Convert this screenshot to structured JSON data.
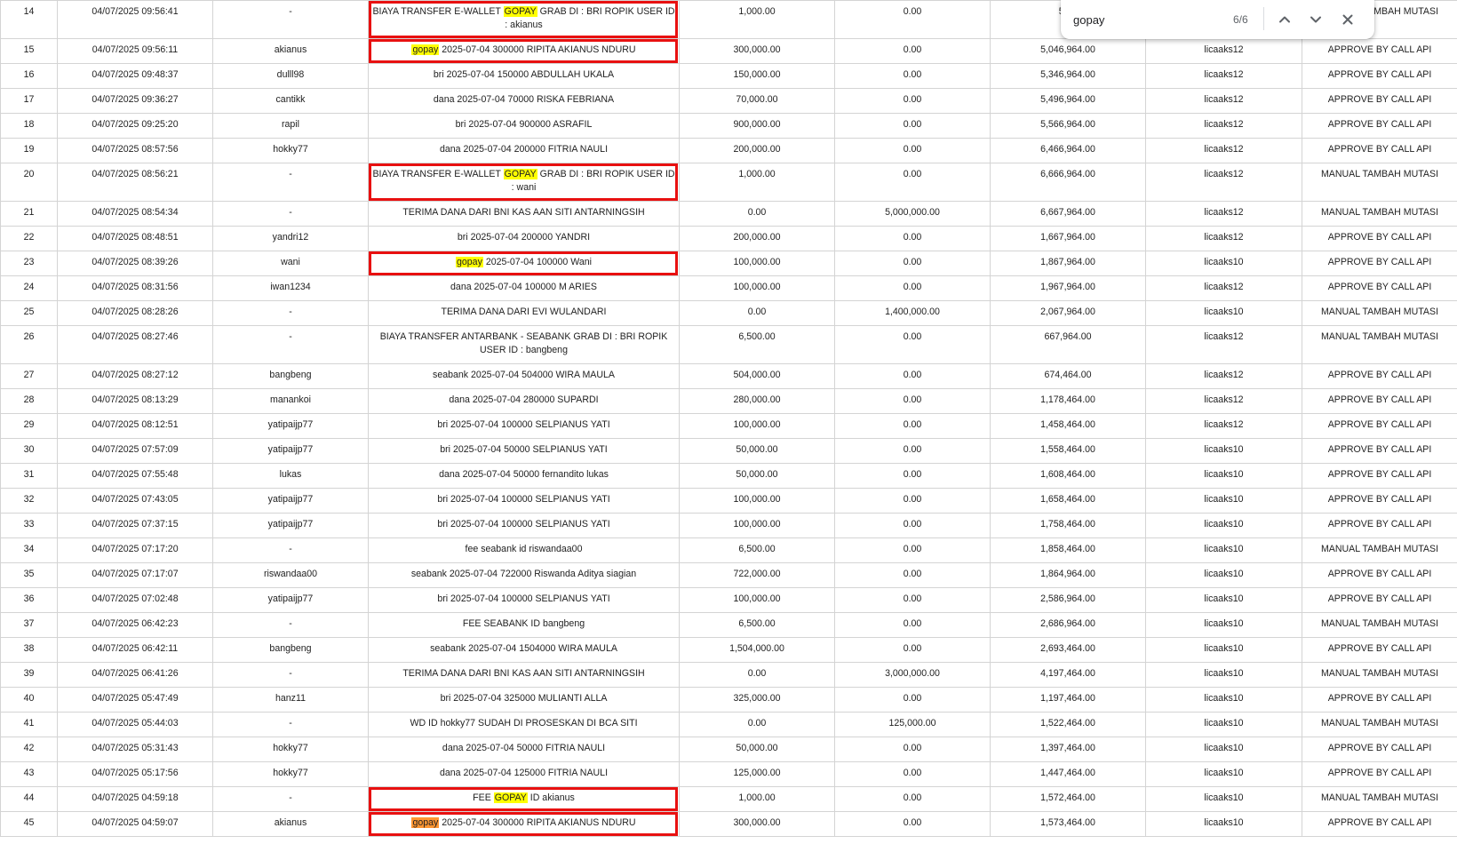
{
  "find_bar": {
    "query": "gopay",
    "match_count": "6/6",
    "prev_icon": "chevron-up-icon",
    "next_icon": "chevron-down-icon",
    "close_icon": "close-icon"
  },
  "colors": {
    "match_highlight": "#ffff00",
    "active_match_highlight": "#ff9632",
    "annotation_box": "#e81010"
  },
  "rows": [
    {
      "no": "14",
      "datetime": "04/07/2025 09:56:41",
      "user": "-",
      "desc": [
        {
          "t": "BIAYA TRANSFER E-WALLET "
        },
        {
          "t": "GOPAY",
          "m": true
        },
        {
          "t": " GRAB DI : BRI ROPIK USER ID : akianus"
        }
      ],
      "debit": "1,000.00",
      "credit": "0.00",
      "balance": "5,04",
      "admin": "",
      "status": "MANUAL TAMBAH MUTASI",
      "tall": true,
      "boxed": true
    },
    {
      "no": "15",
      "datetime": "04/07/2025 09:56:11",
      "user": "akianus",
      "desc": [
        {
          "t": "gopay",
          "m": true
        },
        {
          "t": " 2025-07-04 300000 RIPITA AKIANUS NDURU"
        }
      ],
      "debit": "300,000.00",
      "credit": "0.00",
      "balance": "5,046,964.00",
      "admin": "licaaks12",
      "status": "APPROVE BY CALL API",
      "boxed": true
    },
    {
      "no": "16",
      "datetime": "04/07/2025 09:48:37",
      "user": "dulll98",
      "desc": [
        {
          "t": "bri 2025-07-04 150000 ABDULLAH UKALA"
        }
      ],
      "debit": "150,000.00",
      "credit": "0.00",
      "balance": "5,346,964.00",
      "admin": "licaaks12",
      "status": "APPROVE BY CALL API"
    },
    {
      "no": "17",
      "datetime": "04/07/2025 09:36:27",
      "user": "cantikk",
      "desc": [
        {
          "t": "dana 2025-07-04 70000 RISKA FEBRIANA"
        }
      ],
      "debit": "70,000.00",
      "credit": "0.00",
      "balance": "5,496,964.00",
      "admin": "licaaks12",
      "status": "APPROVE BY CALL API"
    },
    {
      "no": "18",
      "datetime": "04/07/2025 09:25:20",
      "user": "rapil",
      "desc": [
        {
          "t": "bri 2025-07-04 900000 ASRAFIL"
        }
      ],
      "debit": "900,000.00",
      "credit": "0.00",
      "balance": "5,566,964.00",
      "admin": "licaaks12",
      "status": "APPROVE BY CALL API"
    },
    {
      "no": "19",
      "datetime": "04/07/2025 08:57:56",
      "user": "hokky77",
      "desc": [
        {
          "t": "dana 2025-07-04 200000 FITRIA NAULI"
        }
      ],
      "debit": "200,000.00",
      "credit": "0.00",
      "balance": "6,466,964.00",
      "admin": "licaaks12",
      "status": "APPROVE BY CALL API"
    },
    {
      "no": "20",
      "datetime": "04/07/2025 08:56:21",
      "user": "-",
      "desc": [
        {
          "t": "BIAYA TRANSFER E-WALLET "
        },
        {
          "t": "GOPAY",
          "m": true
        },
        {
          "t": " GRAB DI : BRI ROPIK USER ID : wani"
        }
      ],
      "debit": "1,000.00",
      "credit": "0.00",
      "balance": "6,666,964.00",
      "admin": "licaaks12",
      "status": "MANUAL TAMBAH MUTASI",
      "tall": true,
      "boxed": true
    },
    {
      "no": "21",
      "datetime": "04/07/2025 08:54:34",
      "user": "-",
      "desc": [
        {
          "t": "TERIMA DANA DARI BNI KAS AAN SITI ANTARNINGSIH"
        }
      ],
      "debit": "0.00",
      "credit": "5,000,000.00",
      "balance": "6,667,964.00",
      "admin": "licaaks12",
      "status": "MANUAL TAMBAH MUTASI"
    },
    {
      "no": "22",
      "datetime": "04/07/2025 08:48:51",
      "user": "yandri12",
      "desc": [
        {
          "t": "bri 2025-07-04 200000 YANDRI"
        }
      ],
      "debit": "200,000.00",
      "credit": "0.00",
      "balance": "1,667,964.00",
      "admin": "licaaks12",
      "status": "APPROVE BY CALL API"
    },
    {
      "no": "23",
      "datetime": "04/07/2025 08:39:26",
      "user": "wani",
      "desc": [
        {
          "t": "gopay",
          "m": true
        },
        {
          "t": " 2025-07-04 100000 Wani"
        }
      ],
      "debit": "100,000.00",
      "credit": "0.00",
      "balance": "1,867,964.00",
      "admin": "licaaks10",
      "status": "APPROVE BY CALL API",
      "boxed": true
    },
    {
      "no": "24",
      "datetime": "04/07/2025 08:31:56",
      "user": "iwan1234",
      "desc": [
        {
          "t": "dana 2025-07-04 100000 M ARIES"
        }
      ],
      "debit": "100,000.00",
      "credit": "0.00",
      "balance": "1,967,964.00",
      "admin": "licaaks12",
      "status": "APPROVE BY CALL API"
    },
    {
      "no": "25",
      "datetime": "04/07/2025 08:28:26",
      "user": "-",
      "desc": [
        {
          "t": "TERIMA DANA DARI EVI WULANDARI"
        }
      ],
      "debit": "0.00",
      "credit": "1,400,000.00",
      "balance": "2,067,964.00",
      "admin": "licaaks10",
      "status": "MANUAL TAMBAH MUTASI"
    },
    {
      "no": "26",
      "datetime": "04/07/2025 08:27:46",
      "user": "-",
      "desc": [
        {
          "t": "BIAYA TRANSFER ANTARBANK - SEABANK GRAB DI : BRI ROPIK USER ID : bangbeng"
        }
      ],
      "debit": "6,500.00",
      "credit": "0.00",
      "balance": "667,964.00",
      "admin": "licaaks12",
      "status": "MANUAL TAMBAH MUTASI",
      "tall": true
    },
    {
      "no": "27",
      "datetime": "04/07/2025 08:27:12",
      "user": "bangbeng",
      "desc": [
        {
          "t": "seabank 2025-07-04 504000 WIRA MAULA"
        }
      ],
      "debit": "504,000.00",
      "credit": "0.00",
      "balance": "674,464.00",
      "admin": "licaaks12",
      "status": "APPROVE BY CALL API"
    },
    {
      "no": "28",
      "datetime": "04/07/2025 08:13:29",
      "user": "manankoi",
      "desc": [
        {
          "t": "dana 2025-07-04 280000 SUPARDI"
        }
      ],
      "debit": "280,000.00",
      "credit": "0.00",
      "balance": "1,178,464.00",
      "admin": "licaaks12",
      "status": "APPROVE BY CALL API"
    },
    {
      "no": "29",
      "datetime": "04/07/2025 08:12:51",
      "user": "yatipaijp77",
      "desc": [
        {
          "t": "bri 2025-07-04 100000 SELPIANUS YATI"
        }
      ],
      "debit": "100,000.00",
      "credit": "0.00",
      "balance": "1,458,464.00",
      "admin": "licaaks12",
      "status": "APPROVE BY CALL API"
    },
    {
      "no": "30",
      "datetime": "04/07/2025 07:57:09",
      "user": "yatipaijp77",
      "desc": [
        {
          "t": "bri 2025-07-04 50000 SELPIANUS YATI"
        }
      ],
      "debit": "50,000.00",
      "credit": "0.00",
      "balance": "1,558,464.00",
      "admin": "licaaks10",
      "status": "APPROVE BY CALL API"
    },
    {
      "no": "31",
      "datetime": "04/07/2025 07:55:48",
      "user": "lukas",
      "desc": [
        {
          "t": "dana 2025-07-04 50000 fernandito lukas"
        }
      ],
      "debit": "50,000.00",
      "credit": "0.00",
      "balance": "1,608,464.00",
      "admin": "licaaks10",
      "status": "APPROVE BY CALL API"
    },
    {
      "no": "32",
      "datetime": "04/07/2025 07:43:05",
      "user": "yatipaijp77",
      "desc": [
        {
          "t": "bri 2025-07-04 100000 SELPIANUS YATI"
        }
      ],
      "debit": "100,000.00",
      "credit": "0.00",
      "balance": "1,658,464.00",
      "admin": "licaaks10",
      "status": "APPROVE BY CALL API"
    },
    {
      "no": "33",
      "datetime": "04/07/2025 07:37:15",
      "user": "yatipaijp77",
      "desc": [
        {
          "t": "bri 2025-07-04 100000 SELPIANUS YATI"
        }
      ],
      "debit": "100,000.00",
      "credit": "0.00",
      "balance": "1,758,464.00",
      "admin": "licaaks10",
      "status": "APPROVE BY CALL API"
    },
    {
      "no": "34",
      "datetime": "04/07/2025 07:17:20",
      "user": "-",
      "desc": [
        {
          "t": "fee seabank id riswandaa00"
        }
      ],
      "debit": "6,500.00",
      "credit": "0.00",
      "balance": "1,858,464.00",
      "admin": "licaaks10",
      "status": "MANUAL TAMBAH MUTASI"
    },
    {
      "no": "35",
      "datetime": "04/07/2025 07:17:07",
      "user": "riswandaa00",
      "desc": [
        {
          "t": "seabank 2025-07-04 722000 Riswanda Aditya siagian"
        }
      ],
      "debit": "722,000.00",
      "credit": "0.00",
      "balance": "1,864,964.00",
      "admin": "licaaks10",
      "status": "APPROVE BY CALL API"
    },
    {
      "no": "36",
      "datetime": "04/07/2025 07:02:48",
      "user": "yatipaijp77",
      "desc": [
        {
          "t": "bri 2025-07-04 100000 SELPIANUS YATI"
        }
      ],
      "debit": "100,000.00",
      "credit": "0.00",
      "balance": "2,586,964.00",
      "admin": "licaaks10",
      "status": "APPROVE BY CALL API"
    },
    {
      "no": "37",
      "datetime": "04/07/2025 06:42:23",
      "user": "-",
      "desc": [
        {
          "t": "FEE SEABANK ID bangbeng"
        }
      ],
      "debit": "6,500.00",
      "credit": "0.00",
      "balance": "2,686,964.00",
      "admin": "licaaks10",
      "status": "MANUAL TAMBAH MUTASI"
    },
    {
      "no": "38",
      "datetime": "04/07/2025 06:42:11",
      "user": "bangbeng",
      "desc": [
        {
          "t": "seabank 2025-07-04 1504000 WIRA MAULA"
        }
      ],
      "debit": "1,504,000.00",
      "credit": "0.00",
      "balance": "2,693,464.00",
      "admin": "licaaks10",
      "status": "APPROVE BY CALL API"
    },
    {
      "no": "39",
      "datetime": "04/07/2025 06:41:26",
      "user": "-",
      "desc": [
        {
          "t": "TERIMA DANA DARI BNI KAS AAN SITI ANTARNINGSIH"
        }
      ],
      "debit": "0.00",
      "credit": "3,000,000.00",
      "balance": "4,197,464.00",
      "admin": "licaaks10",
      "status": "MANUAL TAMBAH MUTASI"
    },
    {
      "no": "40",
      "datetime": "04/07/2025 05:47:49",
      "user": "hanz11",
      "desc": [
        {
          "t": "bri 2025-07-04 325000 MULIANTI ALLA"
        }
      ],
      "debit": "325,000.00",
      "credit": "0.00",
      "balance": "1,197,464.00",
      "admin": "licaaks10",
      "status": "APPROVE BY CALL API"
    },
    {
      "no": "41",
      "datetime": "04/07/2025 05:44:03",
      "user": "-",
      "desc": [
        {
          "t": "WD ID hokky77 SUDAH DI PROSESKAN DI BCA SITI"
        }
      ],
      "debit": "0.00",
      "credit": "125,000.00",
      "balance": "1,522,464.00",
      "admin": "licaaks10",
      "status": "MANUAL TAMBAH MUTASI"
    },
    {
      "no": "42",
      "datetime": "04/07/2025 05:31:43",
      "user": "hokky77",
      "desc": [
        {
          "t": "dana 2025-07-04 50000 FITRIA NAULI"
        }
      ],
      "debit": "50,000.00",
      "credit": "0.00",
      "balance": "1,397,464.00",
      "admin": "licaaks10",
      "status": "APPROVE BY CALL API"
    },
    {
      "no": "43",
      "datetime": "04/07/2025 05:17:56",
      "user": "hokky77",
      "desc": [
        {
          "t": "dana 2025-07-04 125000 FITRIA NAULI"
        }
      ],
      "debit": "125,000.00",
      "credit": "0.00",
      "balance": "1,447,464.00",
      "admin": "licaaks10",
      "status": "APPROVE BY CALL API"
    },
    {
      "no": "44",
      "datetime": "04/07/2025 04:59:18",
      "user": "-",
      "desc": [
        {
          "t": "FEE "
        },
        {
          "t": "GOPAY",
          "m": true
        },
        {
          "t": " ID akianus"
        }
      ],
      "debit": "1,000.00",
      "credit": "0.00",
      "balance": "1,572,464.00",
      "admin": "licaaks10",
      "status": "MANUAL TAMBAH MUTASI",
      "boxed": true
    },
    {
      "no": "45",
      "datetime": "04/07/2025 04:59:07",
      "user": "akianus",
      "desc": [
        {
          "t": "gopay",
          "m": true,
          "active": true
        },
        {
          "t": " 2025-07-04 300000 RIPITA AKIANUS NDURU"
        }
      ],
      "debit": "300,000.00",
      "credit": "0.00",
      "balance": "1,573,464.00",
      "admin": "licaaks10",
      "status": "APPROVE BY CALL API",
      "boxed": true
    }
  ]
}
